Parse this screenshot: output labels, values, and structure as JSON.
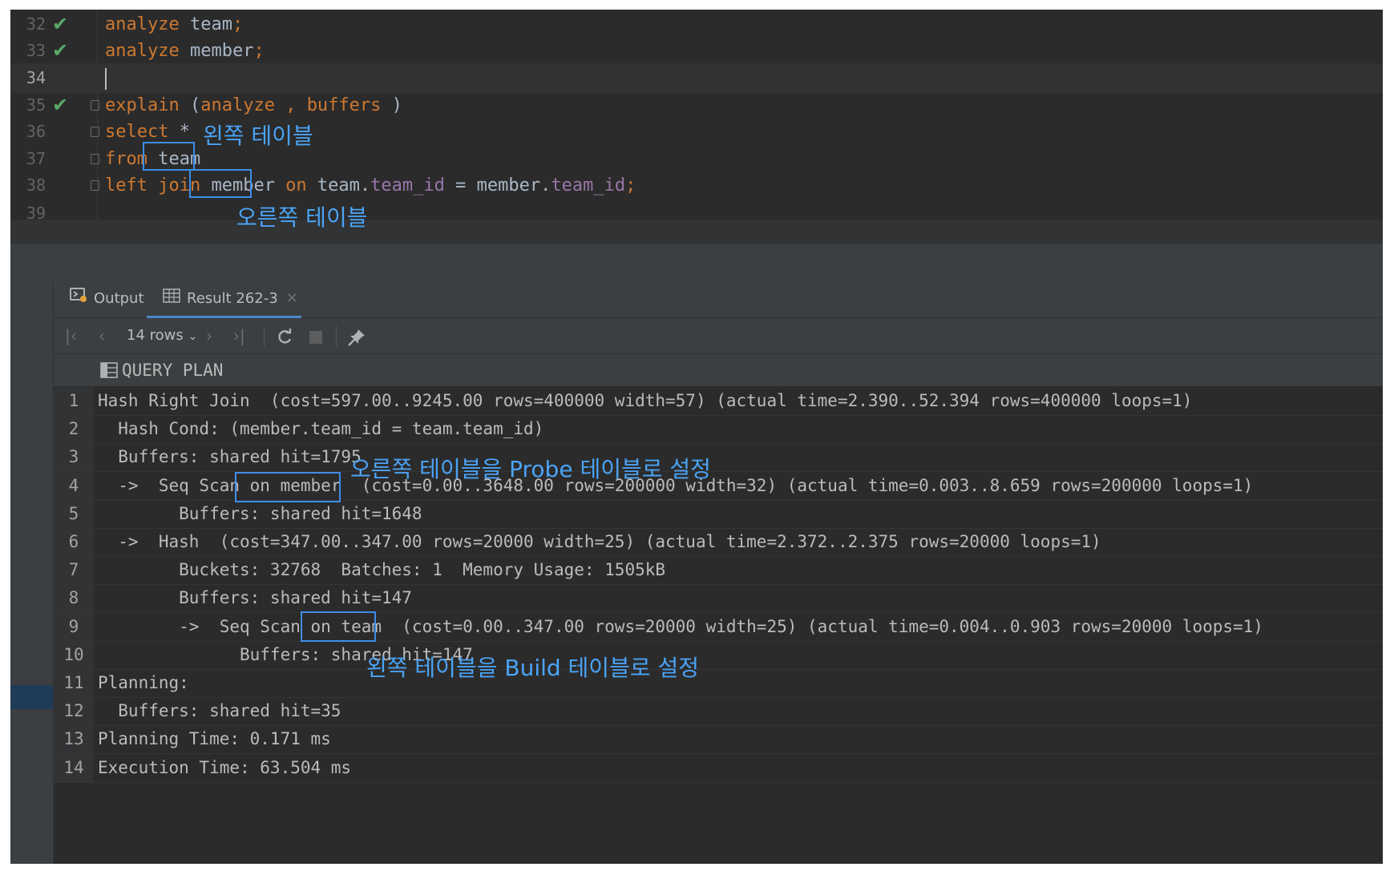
{
  "editor": {
    "lines": [
      {
        "num": "32",
        "status": "check-icon",
        "tokens": [
          {
            "t": "analyze",
            "c": "kw"
          },
          {
            "t": " team"
          },
          {
            "t": ";",
            "c": "kw"
          }
        ]
      },
      {
        "num": "33",
        "status": "check-icon",
        "tokens": [
          {
            "t": "analyze",
            "c": "kw"
          },
          {
            "t": " member"
          },
          {
            "t": ";",
            "c": "kw"
          }
        ]
      },
      {
        "num": "34",
        "status": "",
        "current": true,
        "tokens": []
      },
      {
        "num": "35",
        "status": "check-icon",
        "tokens": [
          {
            "t": "explain",
            "c": "kw"
          },
          {
            "t": " ("
          },
          {
            "t": "analyze",
            "c": "kw"
          },
          {
            "t": " , ",
            "c": "kw"
          },
          {
            "t": "buffers",
            "c": "kw"
          },
          {
            "t": " )"
          }
        ]
      },
      {
        "num": "36",
        "status": "",
        "tokens": [
          {
            "t": "select",
            "c": "kw"
          },
          {
            "t": " *"
          }
        ]
      },
      {
        "num": "37",
        "status": "",
        "tokens": [
          {
            "t": "from",
            "c": "kw"
          },
          {
            "t": " team"
          }
        ]
      },
      {
        "num": "38",
        "status": "",
        "tokens": [
          {
            "t": "left join",
            "c": "kw"
          },
          {
            "t": " member "
          },
          {
            "t": "on",
            "c": "kw"
          },
          {
            "t": " team."
          },
          {
            "t": "team_id",
            "c": "fld"
          },
          {
            "t": " = member."
          },
          {
            "t": "team_id",
            "c": "fld"
          },
          {
            "t": ";",
            "c": "kw"
          }
        ]
      },
      {
        "num": "39",
        "status": "",
        "tokens": []
      }
    ]
  },
  "annotations": {
    "left_table": "왼쪽 테이블",
    "right_table": "오른쪽 테이블",
    "probe": "오른쪽 테이블을 Probe 테이블로 설정",
    "build": "왼쪽 테이블을 Build 테이블로 설정",
    "color": "#4aa3f5"
  },
  "tabs": [
    {
      "label": "Output",
      "icon": "console-output-icon"
    },
    {
      "label": "Result 262-3",
      "icon": "table-grid-icon",
      "active": true
    }
  ],
  "toolbar": {
    "rows_label": "14 rows"
  },
  "grid": {
    "column": "QUERY PLAN",
    "rows": [
      {
        "n": "1",
        "text": "Hash Right Join  (cost=597.00..9245.00 rows=400000 width=57) (actual time=2.390..52.394 rows=400000 loops=1)"
      },
      {
        "n": "2",
        "text": "  Hash Cond: (member.team_id = team.team_id)"
      },
      {
        "n": "3",
        "text": "  Buffers: shared hit=1795"
      },
      {
        "n": "4",
        "text": "  ->  Seq Scan on member  (cost=0.00..3648.00 rows=200000 width=32) (actual time=0.003..8.659 rows=200000 loops=1)"
      },
      {
        "n": "5",
        "text": "        Buffers: shared hit=1648"
      },
      {
        "n": "6",
        "text": "  ->  Hash  (cost=347.00..347.00 rows=20000 width=25) (actual time=2.372..2.375 rows=20000 loops=1)"
      },
      {
        "n": "7",
        "text": "        Buckets: 32768  Batches: 1  Memory Usage: 1505kB"
      },
      {
        "n": "8",
        "text": "        Buffers: shared hit=147"
      },
      {
        "n": "9",
        "text": "        ->  Seq Scan on team  (cost=0.00..347.00 rows=20000 width=25) (actual time=0.004..0.903 rows=20000 loops=1)"
      },
      {
        "n": "10",
        "text": "              Buffers: shared hit=147"
      },
      {
        "n": "11",
        "text": "Planning:"
      },
      {
        "n": "12",
        "text": "  Buffers: shared hit=35"
      },
      {
        "n": "13",
        "text": "Planning Time: 0.171 ms"
      },
      {
        "n": "14",
        "text": "Execution Time: 63.504 ms"
      }
    ]
  }
}
